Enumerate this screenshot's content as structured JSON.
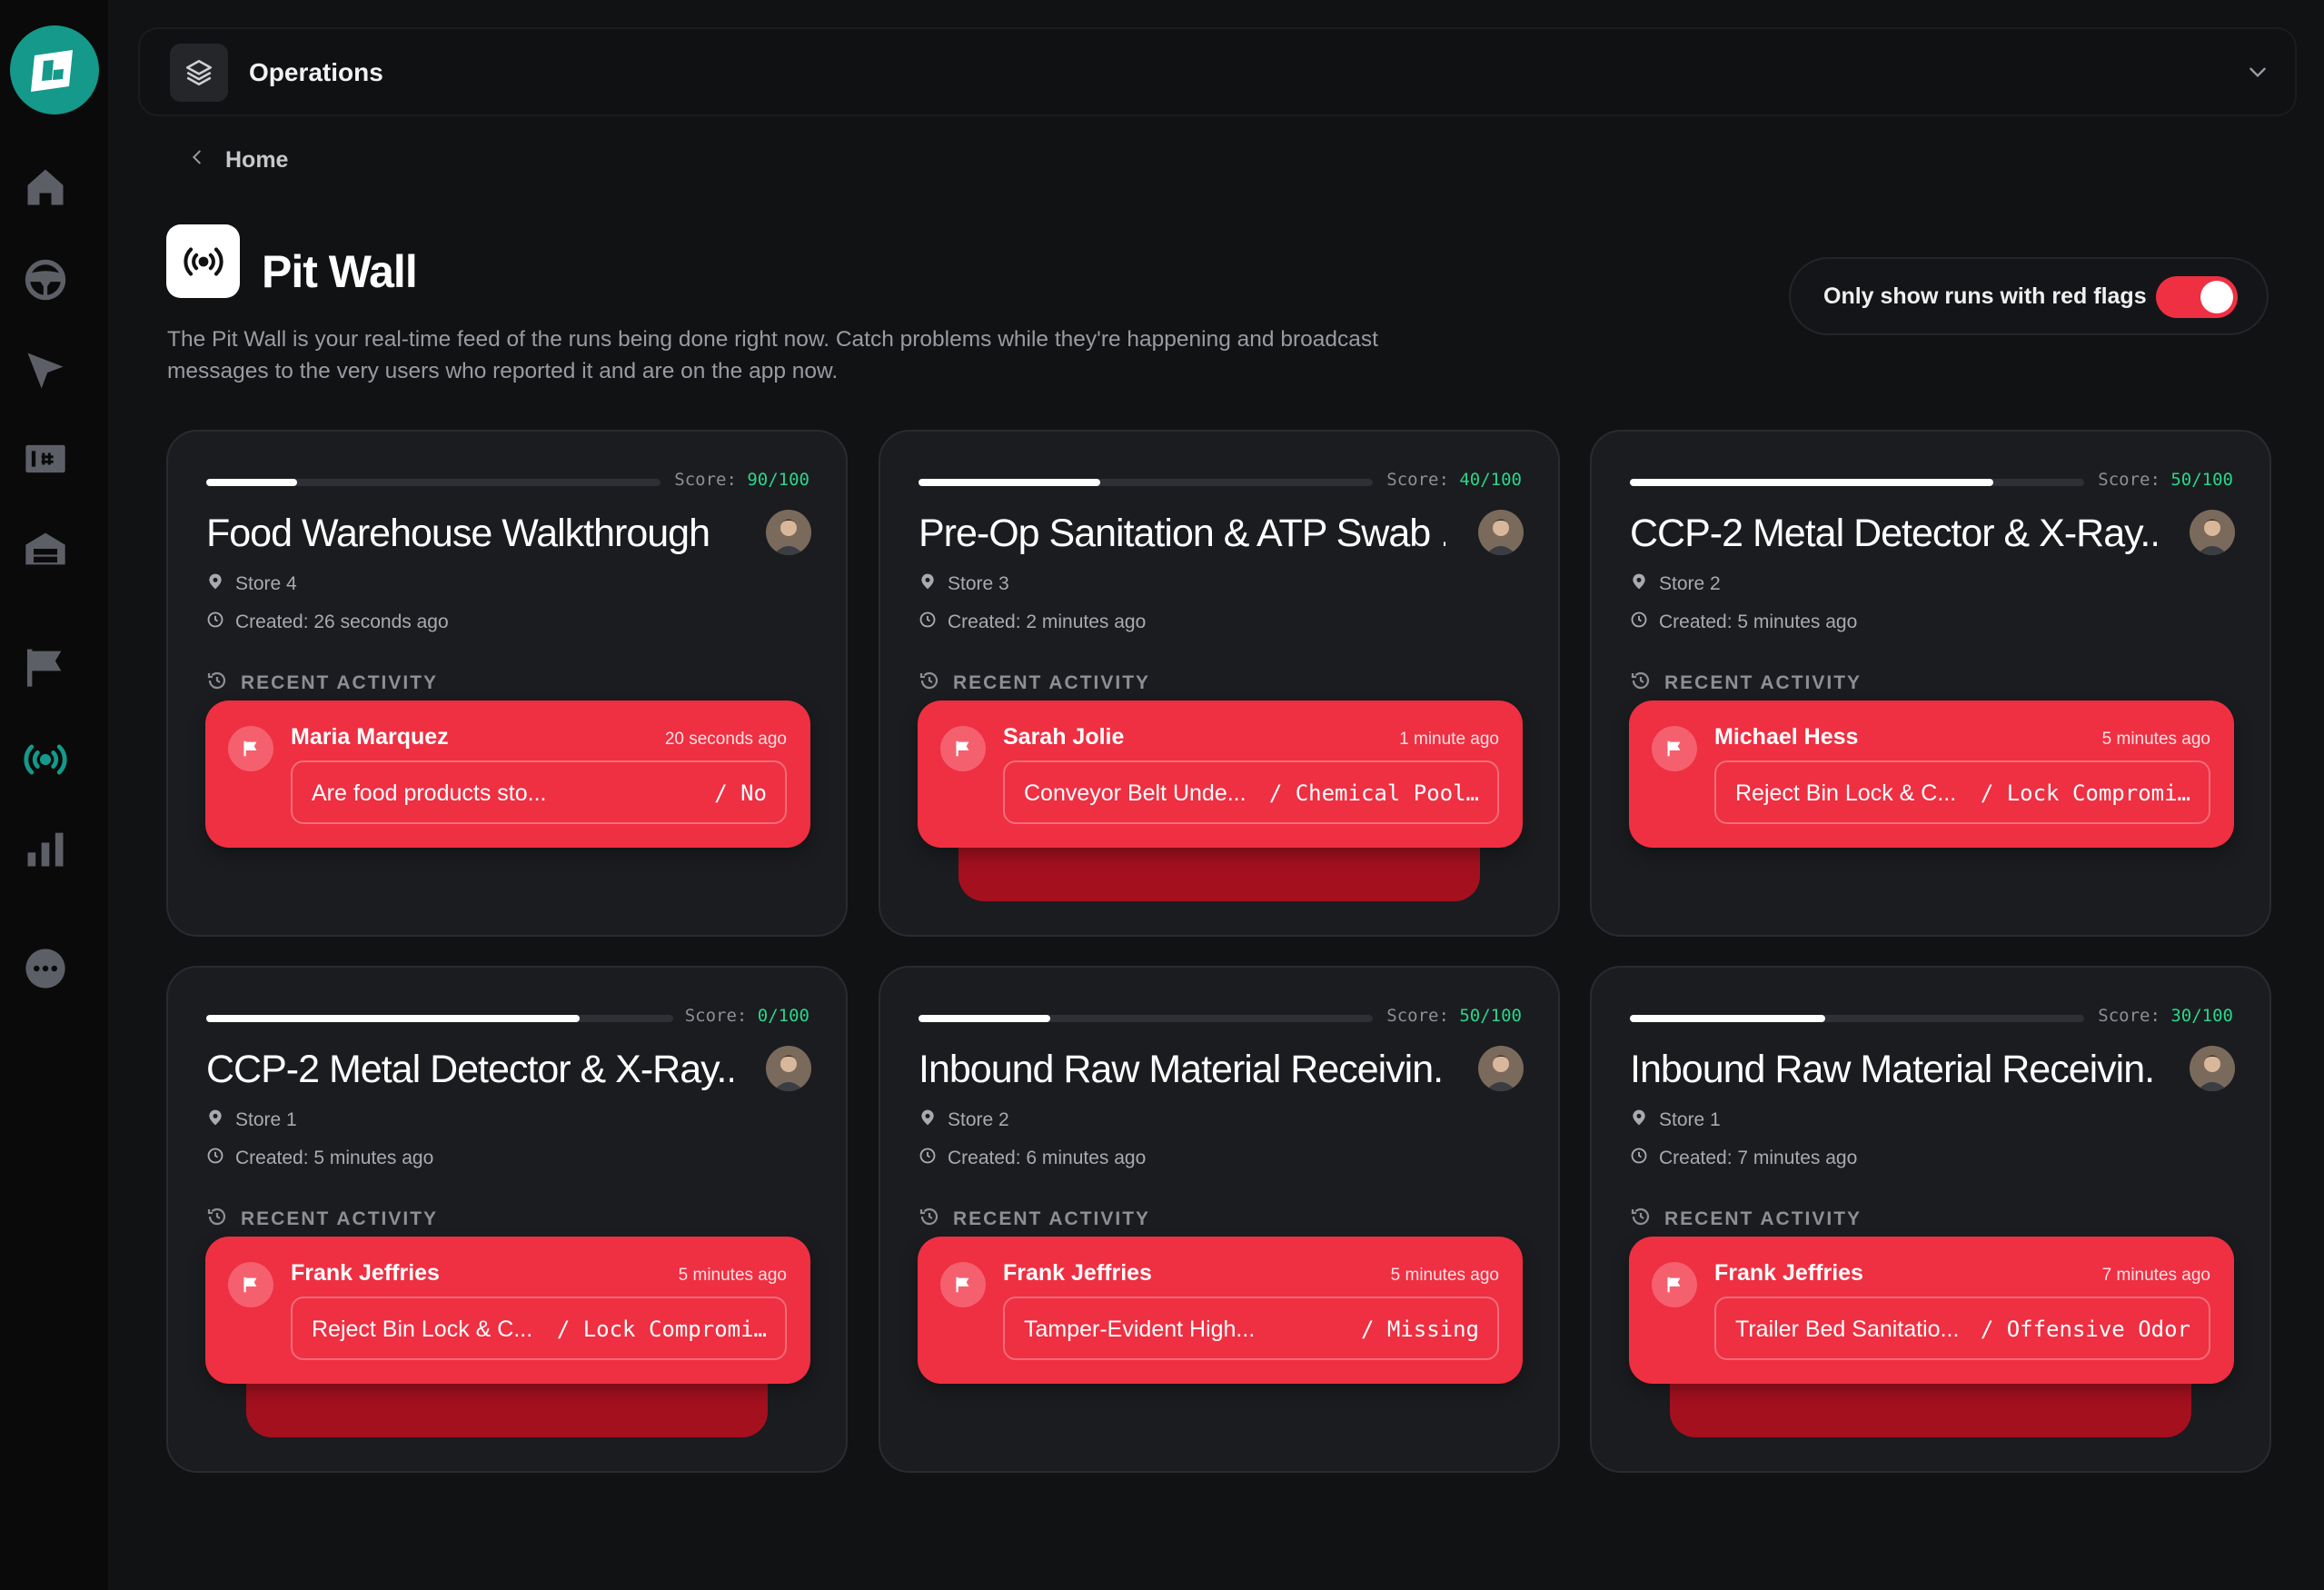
{
  "header": {
    "workspace": "Operations"
  },
  "breadcrumb": {
    "back_label": "Home"
  },
  "page": {
    "title": "Pit Wall",
    "description": "The Pit Wall is your real-time feed of the runs being done right now. Catch problems while they're happening and broadcast messages to the very users who reported it and are on the app now."
  },
  "filter": {
    "label": "Only show runs with red flags",
    "enabled": true
  },
  "sidebar": {
    "items": [
      "home-icon",
      "steering-wheel-icon",
      "send-icon",
      "ticket-icon",
      "warehouse-icon",
      "flag-icon",
      "broadcast-icon",
      "bar-chart-icon",
      "more-icon"
    ],
    "active": "broadcast-icon"
  },
  "labels": {
    "recent_activity": "RECENT ACTIVITY",
    "score_prefix": "Score:",
    "score_max": "/100"
  },
  "colors": {
    "accent": "#ef2f42",
    "score": "#2bd58a",
    "active_nav": "#14998a",
    "background": "#111214",
    "card": "#1b1c1f"
  },
  "runs": [
    {
      "title": "Food Warehouse Walkthrough",
      "score": "90",
      "progress": 0.2,
      "store": "Store 4",
      "created": "Created: 26 seconds ago",
      "stacked": false,
      "flag": {
        "name": "Maria Marquez",
        "time": "20 seconds ago",
        "question": "Are food products sto...",
        "answer": "/ No"
      }
    },
    {
      "title": "Pre-Op Sanitation & ATP Swab ...",
      "score": "40",
      "progress": 0.4,
      "store": "Store 3",
      "created": "Created: 2 minutes ago",
      "stacked": true,
      "flag": {
        "name": "Sarah Jolie",
        "time": "1 minute ago",
        "question": "Conveyor Belt Unde...",
        "answer": "/ Chemical Pool…"
      }
    },
    {
      "title": "CCP-2 Metal Detector & X-Ray...",
      "score": "50",
      "progress": 0.8,
      "store": "Store 2",
      "created": "Created: 5 minutes ago",
      "stacked": false,
      "flag": {
        "name": "Michael Hess",
        "time": "5 minutes ago",
        "question": "Reject Bin Lock & C...",
        "answer": "/ Lock Compromi…"
      }
    },
    {
      "title": "CCP-2 Metal Detector & X-Ray...",
      "score": "0",
      "progress": 0.8,
      "store": "Store 1",
      "created": "Created: 5 minutes ago",
      "stacked": true,
      "flag": {
        "name": "Frank Jeffries",
        "time": "5 minutes ago",
        "question": "Reject Bin Lock & C...",
        "answer": "/ Lock Compromi…"
      }
    },
    {
      "title": "Inbound Raw Material Receivin...",
      "score": "50",
      "progress": 0.29,
      "store": "Store 2",
      "created": "Created: 6 minutes ago",
      "stacked": false,
      "flag": {
        "name": "Frank Jeffries",
        "time": "5 minutes ago",
        "question": "Tamper-Evident High...",
        "answer": "/ Missing"
      }
    },
    {
      "title": "Inbound Raw Material Receivin...",
      "score": "30",
      "progress": 0.43,
      "store": "Store 1",
      "created": "Created: 7 minutes ago",
      "stacked": true,
      "flag": {
        "name": "Frank Jeffries",
        "time": "7 minutes ago",
        "question": "Trailer Bed Sanitatio...",
        "answer": "/ Offensive Odor"
      }
    }
  ]
}
